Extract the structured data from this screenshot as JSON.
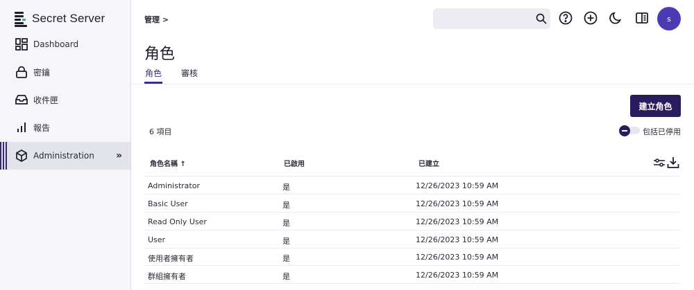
{
  "app": {
    "name": "Secret Server"
  },
  "sidebar": {
    "items": [
      {
        "label": "Dashboard",
        "icon": "dashboard-icon"
      },
      {
        "label": "密鑰",
        "icon": "lock-icon"
      },
      {
        "label": "收件匣",
        "icon": "inbox-icon"
      },
      {
        "label": "報告",
        "icon": "bar-chart-icon"
      },
      {
        "label": "Administration",
        "icon": "cube-icon",
        "active": true
      }
    ],
    "expand_glyph": "»"
  },
  "header": {
    "breadcrumb": "管理 >",
    "search": {
      "value": "",
      "placeholder": ""
    },
    "avatar_initial": "s"
  },
  "page": {
    "title": "角色",
    "tabs": [
      {
        "label": "角色",
        "active": true
      },
      {
        "label": "審核",
        "active": false
      }
    ],
    "create_button": "建立角色",
    "item_count": "6 項目",
    "include_disabled_label": "包括已停用",
    "include_disabled": false
  },
  "table": {
    "columns": [
      "角色名稱 ↑",
      "已啟用",
      "已建立"
    ],
    "rows": [
      {
        "name": "Administrator",
        "enabled": "是",
        "created": "12/26/2023 10:59 AM"
      },
      {
        "name": "Basic User",
        "enabled": "是",
        "created": "12/26/2023 10:59 AM"
      },
      {
        "name": "Read Only User",
        "enabled": "是",
        "created": "12/26/2023 10:59 AM"
      },
      {
        "name": "User",
        "enabled": "是",
        "created": "12/26/2023 10:59 AM"
      },
      {
        "name": "使用者擁有者",
        "enabled": "是",
        "created": "12/26/2023 10:59 AM"
      },
      {
        "name": "群組擁有者",
        "enabled": "是",
        "created": "12/26/2023 10:59 AM"
      }
    ]
  },
  "colors": {
    "accent": "#2a1a5e",
    "avatar": "#4b3cb4",
    "tab_active": "#3d2c8d",
    "brand_green": "#2bb46a"
  }
}
